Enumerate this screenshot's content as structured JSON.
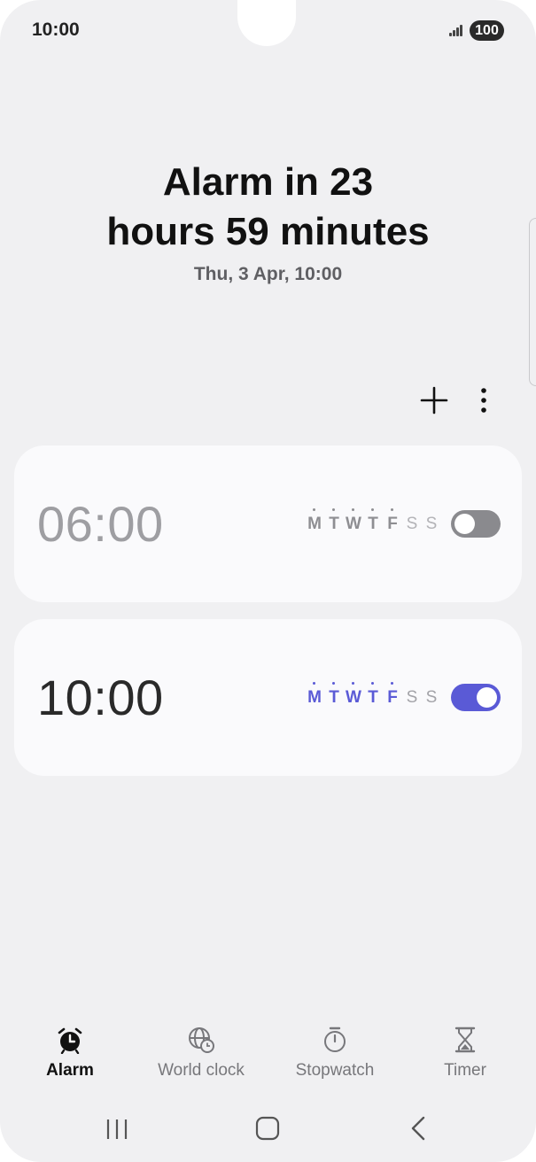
{
  "status_bar": {
    "time": "10:00",
    "battery": "100",
    "icons": [
      "signal-icon",
      "battery-icon"
    ]
  },
  "header": {
    "headline": "Alarm in 23\nhours 59 minutes",
    "subline": "Thu, 3 Apr, 10:00"
  },
  "toolbar": {
    "icons": [
      "add-icon",
      "more-options-icon"
    ]
  },
  "alarms": [
    {
      "time": "06:00",
      "enabled": false,
      "days": [
        {
          "letter": "M",
          "selected": true
        },
        {
          "letter": "T",
          "selected": true
        },
        {
          "letter": "W",
          "selected": true
        },
        {
          "letter": "T",
          "selected": true
        },
        {
          "letter": "F",
          "selected": true
        },
        {
          "letter": "S",
          "selected": false
        },
        {
          "letter": "S",
          "selected": false
        }
      ]
    },
    {
      "time": "10:00",
      "enabled": true,
      "days": [
        {
          "letter": "M",
          "selected": true
        },
        {
          "letter": "T",
          "selected": true
        },
        {
          "letter": "W",
          "selected": true
        },
        {
          "letter": "T",
          "selected": true
        },
        {
          "letter": "F",
          "selected": true
        },
        {
          "letter": "S",
          "selected": false
        },
        {
          "letter": "S",
          "selected": false
        }
      ]
    }
  ],
  "tabs": [
    {
      "label": "Alarm",
      "icon": "alarm-clock-icon",
      "active": true
    },
    {
      "label": "World clock",
      "icon": "globe-clock-icon",
      "active": false
    },
    {
      "label": "Stopwatch",
      "icon": "stopwatch-icon",
      "active": false
    },
    {
      "label": "Timer",
      "icon": "hourglass-icon",
      "active": false
    }
  ],
  "navigation": {
    "icons": [
      "recents-icon",
      "home-icon",
      "back-icon"
    ]
  },
  "colors": {
    "accent": "#5a5ad6",
    "background": "#f0f0f2",
    "card": "#fafafc",
    "toggle_off": "#8a8a8e"
  }
}
